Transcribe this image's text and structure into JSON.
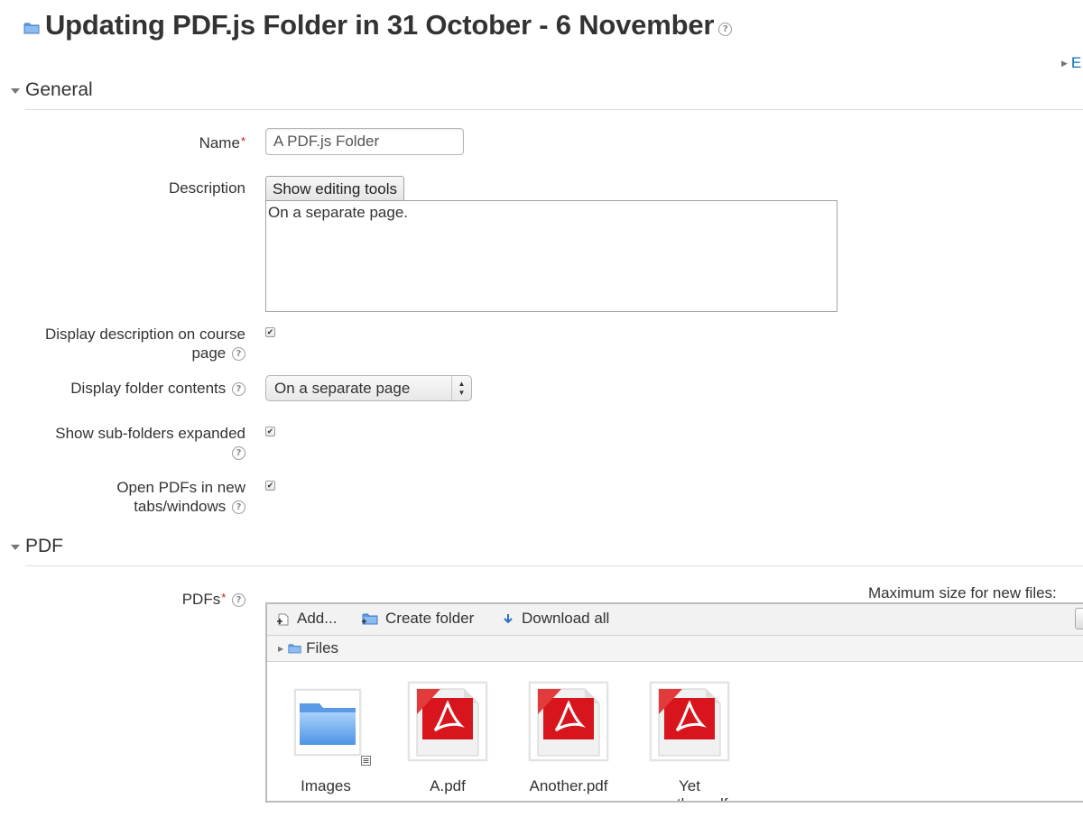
{
  "header": {
    "title": "Updating PDF.js Folder in 31 October - 6 November",
    "expand_all_link": "E"
  },
  "sections": {
    "general": "General",
    "pdf": "PDF"
  },
  "form": {
    "name_label": "Name",
    "name_value": "A PDF.js Folder",
    "description_label": "Description",
    "show_editing_tools": "Show editing tools",
    "description_value": "On a separate page.",
    "display_description_label_line1": "Display description on course",
    "display_description_label_line2": "page",
    "display_description_checked": true,
    "display_folder_contents_label": "Display folder contents",
    "display_folder_contents_value": "On a separate page",
    "show_subfolders_label_line1": "Show sub-folders expanded",
    "show_subfolders_checked": true,
    "open_pdfs_label_line1": "Open PDFs in new",
    "open_pdfs_label_line2": "tabs/windows",
    "open_pdfs_checked": true,
    "pdfs_label": "PDFs",
    "required_marker": "*"
  },
  "filemanager": {
    "max_size_label": "Maximum size for new files:",
    "toolbar": {
      "add": "Add...",
      "create_folder": "Create folder",
      "download_all": "Download all"
    },
    "path_root": "Files",
    "items": [
      {
        "label": "Images",
        "type": "folder"
      },
      {
        "label": "A.pdf",
        "type": "pdf"
      },
      {
        "label": "Another.pdf",
        "type": "pdf"
      },
      {
        "label": "Yet",
        "label_cut": "another.pdf",
        "type": "pdf"
      }
    ]
  },
  "colors": {
    "link_blue": "#0a6fb3",
    "required_red": "#d21414",
    "pdf_red": "#d8151d",
    "folder_blue": "#6aa6e8"
  }
}
